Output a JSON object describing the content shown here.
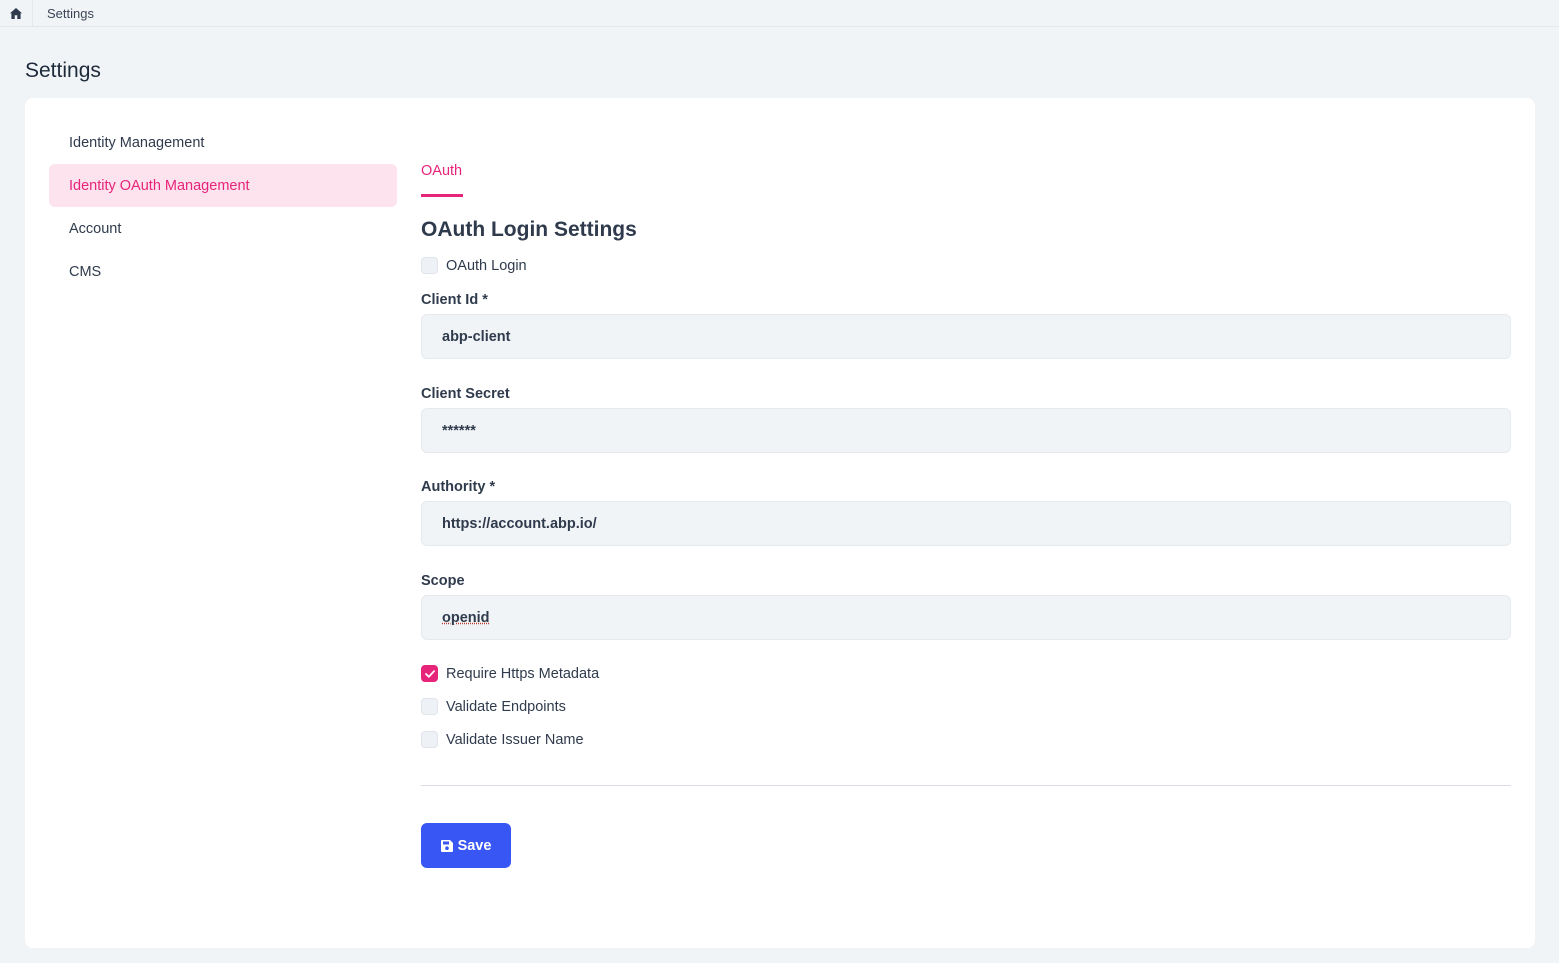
{
  "breadcrumb": {
    "home_icon": "home-icon",
    "current": "Settings"
  },
  "page": {
    "title": "Settings"
  },
  "sidebar": {
    "items": [
      {
        "label": "Identity Management",
        "active": false
      },
      {
        "label": "Identity OAuth Management",
        "active": true
      },
      {
        "label": "Account",
        "active": false
      },
      {
        "label": "CMS",
        "active": false
      }
    ]
  },
  "tabs": [
    {
      "label": "OAuth",
      "active": true
    }
  ],
  "form": {
    "title": "OAuth Login Settings",
    "oauth_login": {
      "label": "OAuth Login",
      "checked": false
    },
    "client_id": {
      "label": "Client Id *",
      "value": "abp-client"
    },
    "client_secret": {
      "label": "Client Secret",
      "value": "******"
    },
    "authority": {
      "label": "Authority *",
      "value": "https://account.abp.io/"
    },
    "scope": {
      "label": "Scope",
      "value": "openid"
    },
    "require_https_metadata": {
      "label": "Require Https Metadata",
      "checked": true
    },
    "validate_endpoints": {
      "label": "Validate Endpoints",
      "checked": false
    },
    "validate_issuer_name": {
      "label": "Validate Issuer Name",
      "checked": false
    },
    "save_label": "Save",
    "save_icon": "floppy-disk-icon"
  },
  "colors": {
    "accent": "#e6247a",
    "accent_bg": "#fde3ee",
    "primary_button": "#3756f4",
    "page_bg": "#f1f4f7"
  }
}
